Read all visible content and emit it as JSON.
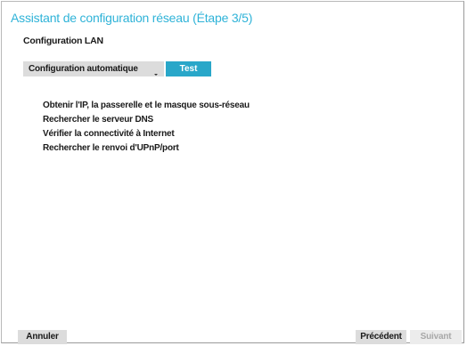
{
  "window": {
    "title": "Assistant de configuration réseau (Étape 3/5)"
  },
  "section": {
    "label": "Configuration LAN"
  },
  "mode_select": {
    "selected": "Configuration automatique",
    "icon": "chevron-down-icon"
  },
  "test_button": {
    "label": "Test"
  },
  "steps": [
    "Obtenir l'IP, la passerelle et le masque sous-réseau",
    "Rechercher le serveur DNS",
    "Vérifier la connectivité à Internet",
    "Rechercher le renvoi d'UPnP/port"
  ],
  "footer": {
    "cancel_label": "Annuler",
    "previous_label": "Précédent",
    "next_label": "Suivant",
    "next_enabled": false
  },
  "colors": {
    "accent": "#2fb3d8",
    "button_primary": "#29a7c9",
    "button_neutral": "#dcdcdc",
    "button_disabled": "#ececec",
    "text_disabled": "#a8a8a8"
  }
}
